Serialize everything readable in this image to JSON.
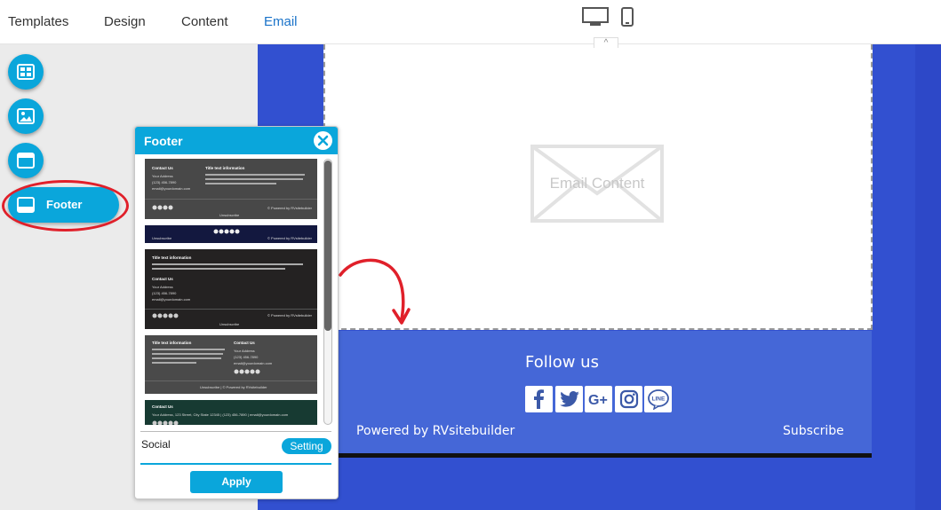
{
  "nav": {
    "templates": "Templates",
    "design": "Design",
    "content": "Content",
    "email": "Email"
  },
  "device_icons": [
    "desktop-icon",
    "mobile-icon"
  ],
  "left_toolbar": {
    "buttons": [
      "layout-icon",
      "image-icon",
      "window-icon"
    ],
    "footer_label": "Footer"
  },
  "canvas": {
    "placeholder": "Email Content",
    "footer": {
      "follow_text": "Follow us",
      "social_icons": [
        "facebook-icon",
        "twitter-icon",
        "google-plus-icon",
        "instagram-icon",
        "line-icon"
      ],
      "powered_text": "Powered by RVsitebuilder",
      "subscribe_text": "Subscribe"
    }
  },
  "footer_panel": {
    "title": "Footer",
    "social_label": "Social",
    "setting_label": "Setting",
    "apply_label": "Apply",
    "templates": [
      {
        "contact": "Contact Us",
        "title": "Title text information",
        "address": "Your Address",
        "phone": "(123) 456-7890",
        "email": "email@yourdomain.com",
        "unsubscribe": "Unsubscribe",
        "powered": "© Powered by RVsitebuilder"
      },
      {
        "unsubscribe": "Unsubscribe",
        "powered": "© Powered by RVsitebuilder"
      },
      {
        "title": "Title text information",
        "contact": "Contact Us",
        "address": "Your Address",
        "phone": "(123) 456-7890",
        "email": "email@yourdomain.com",
        "powered": "© Powered by RVsitebuilder",
        "unsubscribe": "Unsubscribe"
      },
      {
        "title": "Title text information",
        "contact": "Contact Us",
        "address": "Your Address",
        "phone": "(123) 456-7890",
        "email": "email@yourdomain.com",
        "footer": "Unsubscribe | © Powered by RVsitebuilder"
      },
      {
        "contact": "Contact Us",
        "line": "Your Address, 123 Street, City State 12345 | (123) 456-7890 | email@yourdomain.com"
      }
    ]
  },
  "colors": {
    "accent": "#0aa6db",
    "canvas_bg": "#3250d0",
    "footer_band": "#4567d7",
    "highlight": "#e0202a",
    "active_nav": "#1a73c9"
  }
}
